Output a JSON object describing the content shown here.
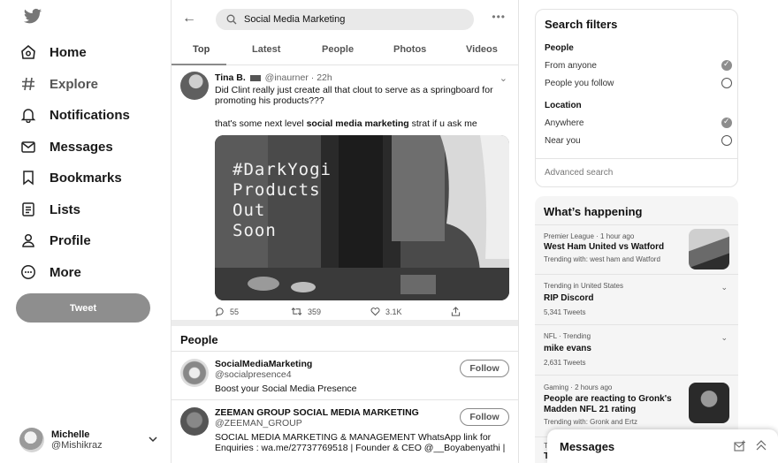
{
  "nav": {
    "items": [
      {
        "label": "Home",
        "icon": "home-icon"
      },
      {
        "label": "Explore",
        "icon": "hashtag-icon"
      },
      {
        "label": "Notifications",
        "icon": "bell-icon"
      },
      {
        "label": "Messages",
        "icon": "envelope-icon"
      },
      {
        "label": "Bookmarks",
        "icon": "bookmark-icon"
      },
      {
        "label": "Lists",
        "icon": "list-icon"
      },
      {
        "label": "Profile",
        "icon": "person-icon"
      },
      {
        "label": "More",
        "icon": "more-circle-icon"
      }
    ],
    "tweet_button": "Tweet",
    "account": {
      "name": "Michelle",
      "handle": "@Mishikraz"
    }
  },
  "search": {
    "value": "Social Media Marketing"
  },
  "tabs": [
    "Top",
    "Latest",
    "People",
    "Photos",
    "Videos"
  ],
  "tweet": {
    "author": "Tina B.",
    "handle": "@inaurner",
    "time": "22h",
    "text1": "Did Clint really just create all that clout to serve as a springboard for promoting his products???",
    "text2_pre": "that's some next level ",
    "text2_bold": "social media marketing",
    "text2_post": " strat if u ask me",
    "media_text": "#DarkYogi\nProducts\nOut\nSoon",
    "replies": "55",
    "retweets": "359",
    "likes": "3.1K"
  },
  "people": {
    "heading": "People",
    "follow_label": "Follow",
    "list": [
      {
        "name": "SocialMediaMarketing",
        "handle": "@socialpresence4",
        "bio": "Boost your Social Media Presence"
      },
      {
        "name": "ZEEMAN GROUP SOCIAL MEDIA MARKETING",
        "handle": "@ZEEMAN_GROUP",
        "bio": "SOCIAL MEDIA MARKETING & MANAGEMENT WhatsApp link for Enquiries : wa.me/27737769518 | Founder & CEO @__Boyabenyathi |"
      }
    ]
  },
  "filters": {
    "title": "Search filters",
    "people_heading": "People",
    "people_opts": [
      "From anyone",
      "People you follow"
    ],
    "location_heading": "Location",
    "location_opts": [
      "Anywhere",
      "Near you"
    ],
    "advanced": "Advanced search"
  },
  "happening": {
    "title": "What’s happening",
    "trends": [
      {
        "meta": "Premier League · 1 hour ago",
        "title": "West Ham United vs Watford",
        "sub": "Trending with: west ham and Watford"
      },
      {
        "meta": "Trending in United States",
        "title": "RIP Discord",
        "sub": "5,341 Tweets"
      },
      {
        "meta": "NFL · Trending",
        "title": "mike evans",
        "sub": "2,631 Tweets"
      },
      {
        "meta": "Gaming · 2 hours ago",
        "title": "People are reacting to Gronk's Madden NFL 21 rating",
        "sub": "Trending with: Gronk and Ertz"
      },
      {
        "meta": "Tr",
        "title": "Ti",
        "sub": ""
      }
    ]
  },
  "messages": {
    "title": "Messages"
  }
}
